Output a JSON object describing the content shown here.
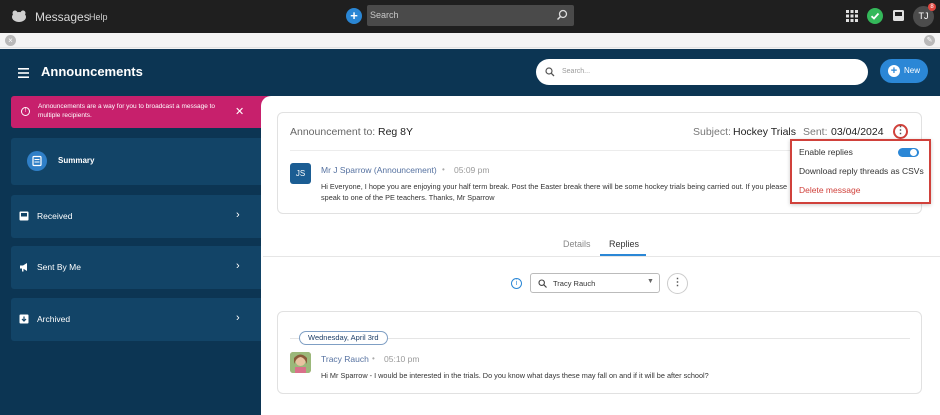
{
  "topbar": {
    "app_title": "Messages",
    "help_label": "Help",
    "search_placeholder": "Search",
    "user_initials": "TJ",
    "badge_count": "8"
  },
  "header": {
    "title": "Announcements",
    "search_placeholder": "Search...",
    "new_label": "New"
  },
  "sidebar": {
    "alert_text": "Announcements are a way for you to broadcast a message to multiple recipients.",
    "items": [
      {
        "label": "Summary"
      },
      {
        "label": "Received"
      },
      {
        "label": "Sent By Me"
      },
      {
        "label": "Archived"
      }
    ]
  },
  "announcement": {
    "to_label": "Announcement to:",
    "to_value": "Reg 8Y",
    "subject_label": "Subject:",
    "subject_value": "Hockey Trials",
    "sent_label": "Sent:",
    "sent_value": "03/04/2024",
    "sender_initials": "JS",
    "sender_name": "Mr J Sparrow (Announcement)",
    "time": "05:09 pm",
    "body": "Hi Everyone, I hope you are enjoying your half term break. Post the Easter break there will be some hockey trials being carried out. If you please speak to one of the PE teachers. Thanks, Mr Sparrow"
  },
  "menu": {
    "enable_replies": "Enable replies",
    "enable_replies_on": true,
    "download": "Download reply threads as CSVs",
    "delete": "Delete message"
  },
  "tabs": {
    "details": "Details",
    "replies": "Replies",
    "active": "Replies"
  },
  "filter": {
    "selected": "Tracy Rauch"
  },
  "reply": {
    "date_chip": "Wednesday, April 3rd",
    "name": "Tracy Rauch",
    "time": "05:10 pm",
    "body": "Hi Mr Sparrow - I would be interested in the trials. Do you know what days these may fall on and if it will be after school?"
  },
  "colors": {
    "frame": "#0c3553",
    "accent": "#2b87d6",
    "alert": "#c7206c",
    "highlight": "#d0413b"
  }
}
